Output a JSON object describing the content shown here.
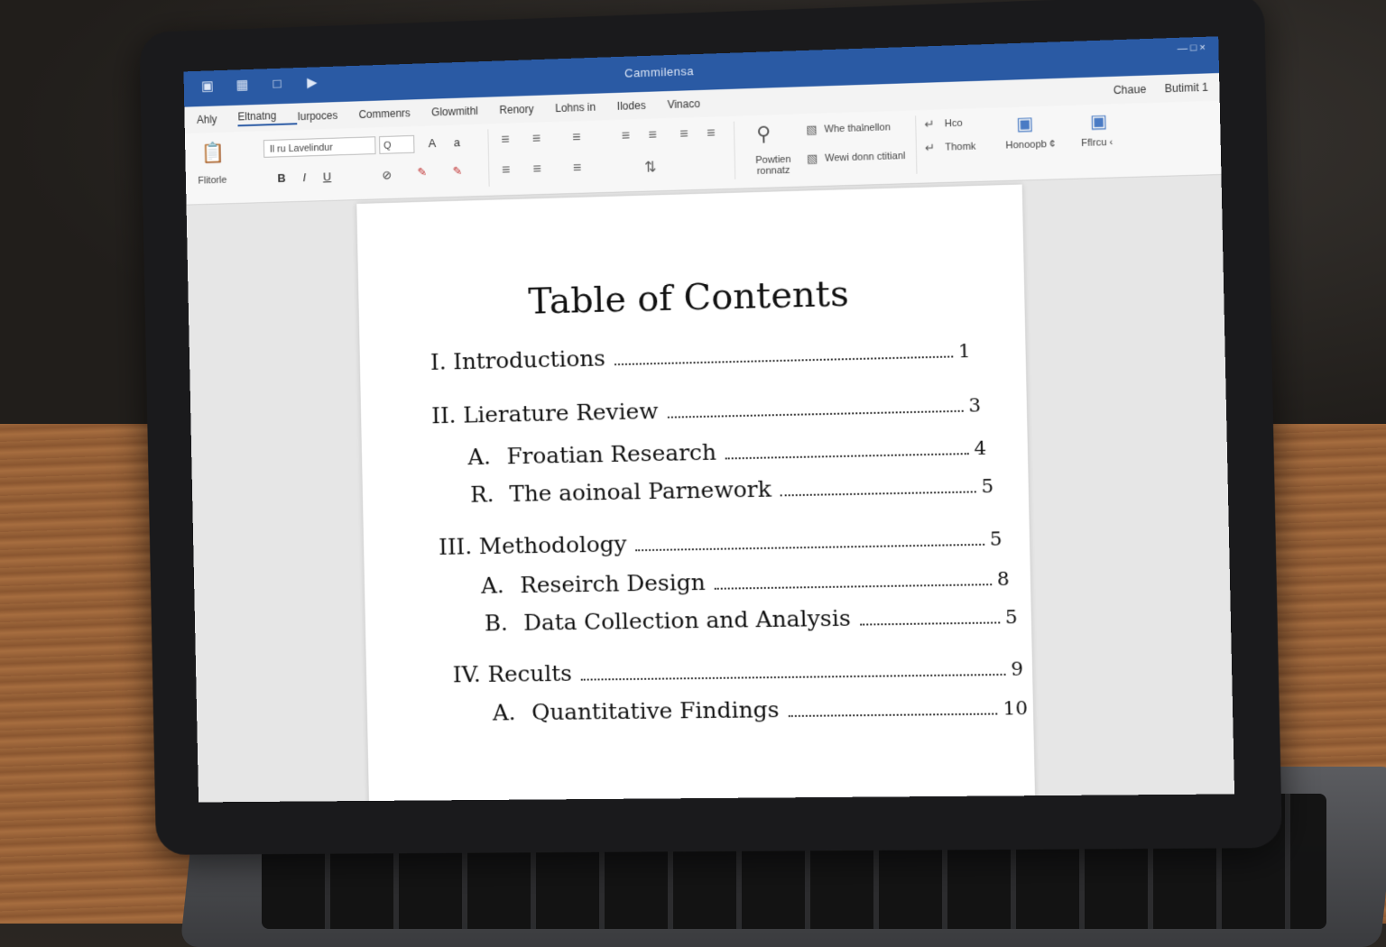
{
  "window": {
    "title": "Cammilensa",
    "quick_access": [
      "save-icon",
      "grid-icon",
      "undo-icon",
      "play-icon"
    ],
    "controls": "— □ ×"
  },
  "ribbon": {
    "tabs": [
      "Ahly",
      "Eltnatng",
      "Iurpoces",
      "Commenrs",
      "Glowmithl",
      "Renory",
      "Lohns in",
      "Ilodes",
      "Vinaco"
    ],
    "right_tabs": [
      "Chaue",
      "Butimit 1"
    ],
    "font_name": "Il ru Lavelindur",
    "font_size": "Q",
    "paste_label": "Flitorle",
    "style_items": [
      "Whe thalnellon",
      "Wewi donn ctitianl"
    ],
    "find_label": "Powtien ronnatz",
    "edit_items": [
      "Hco",
      "Thomk"
    ],
    "group_labels": [
      "Honoopb ¢",
      "Fflrcu ‹"
    ]
  },
  "document": {
    "title": "Table of Contents",
    "entries": [
      {
        "marker": "I.",
        "text": "Introductions",
        "page": "1"
      },
      {
        "marker": "II.",
        "text": "Lierature Review",
        "page": "3"
      },
      {
        "marker": "A.",
        "text": "Froatian Research",
        "page": "4"
      },
      {
        "marker": "R.",
        "text": "The aoinoal Parnework",
        "page": "5"
      },
      {
        "marker": "III.",
        "text": "Methodology",
        "page": "5"
      },
      {
        "marker": "A.",
        "text": "Reseirch Design",
        "page": "8"
      },
      {
        "marker": "B.",
        "text": "Data Collection and Analysis",
        "page": "5"
      },
      {
        "marker": "IV.",
        "text": "Recults",
        "page": "9"
      },
      {
        "marker": "A.",
        "text": "Quantitative Findings",
        "page": "10"
      }
    ]
  },
  "colors": {
    "titlebar": "#2a5aa4",
    "page": "#ffffff"
  }
}
